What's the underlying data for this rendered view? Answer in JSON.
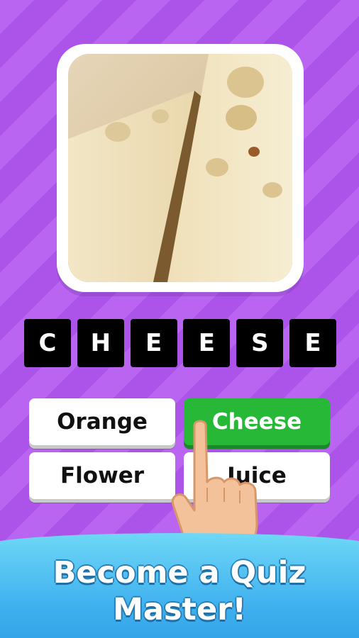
{
  "quiz": {
    "image_subject": "cheese",
    "answer_letters": [
      "C",
      "H",
      "E",
      "E",
      "S",
      "E"
    ],
    "options": [
      {
        "label": "Orange",
        "state": "default"
      },
      {
        "label": "Cheese",
        "state": "correct"
      },
      {
        "label": "Flower",
        "state": "default"
      },
      {
        "label": "Juice",
        "state": "default"
      }
    ]
  },
  "banner": {
    "line1": "Become a Quiz",
    "line2": "Master!"
  },
  "colors": {
    "background": "#b65cf0",
    "correct": "#28b838",
    "tile": "#000000",
    "banner": "#3fb1ee"
  },
  "icons": {
    "pointer": "pointing-hand-icon"
  }
}
